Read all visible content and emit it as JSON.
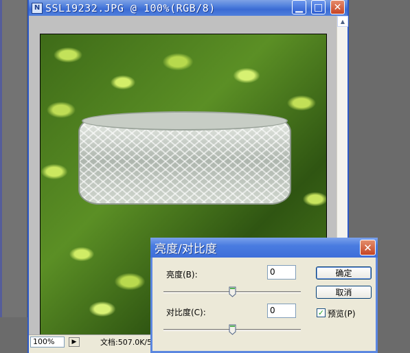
{
  "document": {
    "title": "SSL19232.JPG @ 100%(RGB/8)",
    "icon_glyph": "N",
    "zoom": "100%",
    "status_info": "文档:507.0K/5"
  },
  "window_controls": {
    "minimize": "▁",
    "maximize": "□",
    "close": "✕"
  },
  "dialog": {
    "title": "亮度/对比度",
    "close": "✕",
    "brightness_label": "亮度(B):",
    "brightness_value": "0",
    "brightness_level": 0.5,
    "contrast_label": "对比度(C):",
    "contrast_value": "0",
    "contrast_level": 0.5,
    "ok_label": "确定",
    "cancel_label": "取消",
    "preview_label": "预览(P)",
    "preview_checked": true
  },
  "icons": {
    "app": "document-icon",
    "status": "status-arrow-icon"
  },
  "colors": {
    "titlebar": "#3b6bd3",
    "dialog_frame": "#5b87e0",
    "close_button": "#c74424",
    "canvas_bg": "#c0c0c0"
  }
}
